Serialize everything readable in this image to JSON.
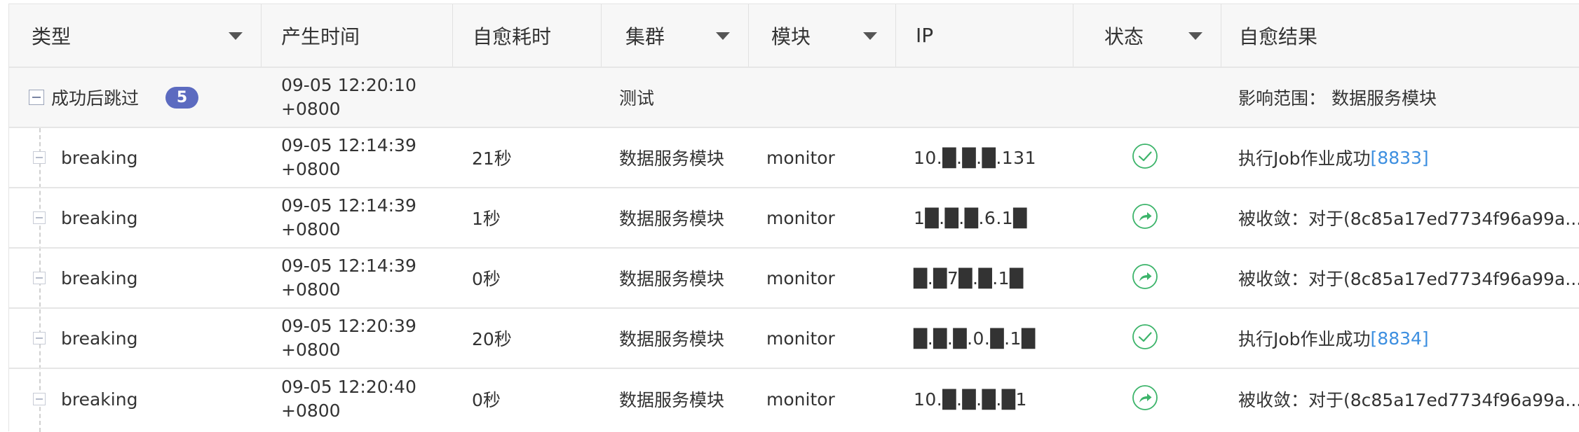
{
  "colors": {
    "success": "#3cb46a",
    "link": "#3d8fe0",
    "badge": "#5c6bc0"
  },
  "header": {
    "columns": [
      {
        "label": "类型",
        "dropdown": true
      },
      {
        "label": "产生时间",
        "dropdown": false
      },
      {
        "label": "自愈耗时",
        "dropdown": false
      },
      {
        "label": "集群",
        "dropdown": true
      },
      {
        "label": "模块",
        "dropdown": true
      },
      {
        "label": "IP",
        "dropdown": false
      },
      {
        "label": "状态",
        "dropdown": true
      },
      {
        "label": "自愈结果",
        "dropdown": false
      }
    ]
  },
  "group": {
    "type_label": "成功后跳过",
    "count": "5",
    "time_line1": "09-05 12:20:10",
    "time_line2": "+0800",
    "cluster": "测试",
    "result": "影响范围： 数据服务模块"
  },
  "rows": [
    {
      "type": "breaking",
      "time_line1": "09-05 12:14:39",
      "time_line2": "+0800",
      "duration": "21秒",
      "cluster": "数据服务模块",
      "module": "monitor",
      "ip": "10.█.█.█.131",
      "status_icon": "check-circle-icon",
      "result_text": "执行Job作业成功",
      "result_link": "[8833]"
    },
    {
      "type": "breaking",
      "time_line1": "09-05 12:14:39",
      "time_line2": "+0800",
      "duration": "1秒",
      "cluster": "数据服务模块",
      "module": "monitor",
      "ip": "1█.█.█.6.1█",
      "status_icon": "forward-circle-icon",
      "result_text": "被收敛：对于(8c85a17ed7734f96a99a...",
      "result_link": ""
    },
    {
      "type": "breaking",
      "time_line1": "09-05 12:14:39",
      "time_line2": "+0800",
      "duration": "0秒",
      "cluster": "数据服务模块",
      "module": "monitor",
      "ip": "█.█7█.█.1█",
      "status_icon": "forward-circle-icon",
      "result_text": "被收敛：对于(8c85a17ed7734f96a99a...",
      "result_link": ""
    },
    {
      "type": "breaking",
      "time_line1": "09-05 12:20:39",
      "time_line2": "+0800",
      "duration": "20秒",
      "cluster": "数据服务模块",
      "module": "monitor",
      "ip": "█.█.█.0.█.1█",
      "status_icon": "check-circle-icon",
      "result_text": "执行Job作业成功",
      "result_link": "[8834]"
    },
    {
      "type": "breaking",
      "time_line1": "09-05 12:20:40",
      "time_line2": "+0800",
      "duration": "0秒",
      "cluster": "数据服务模块",
      "module": "monitor",
      "ip": "10.█.█.█.█1",
      "status_icon": "forward-circle-icon",
      "result_text": "被收敛：对于(8c85a17ed7734f96a99a...",
      "result_link": ""
    }
  ]
}
